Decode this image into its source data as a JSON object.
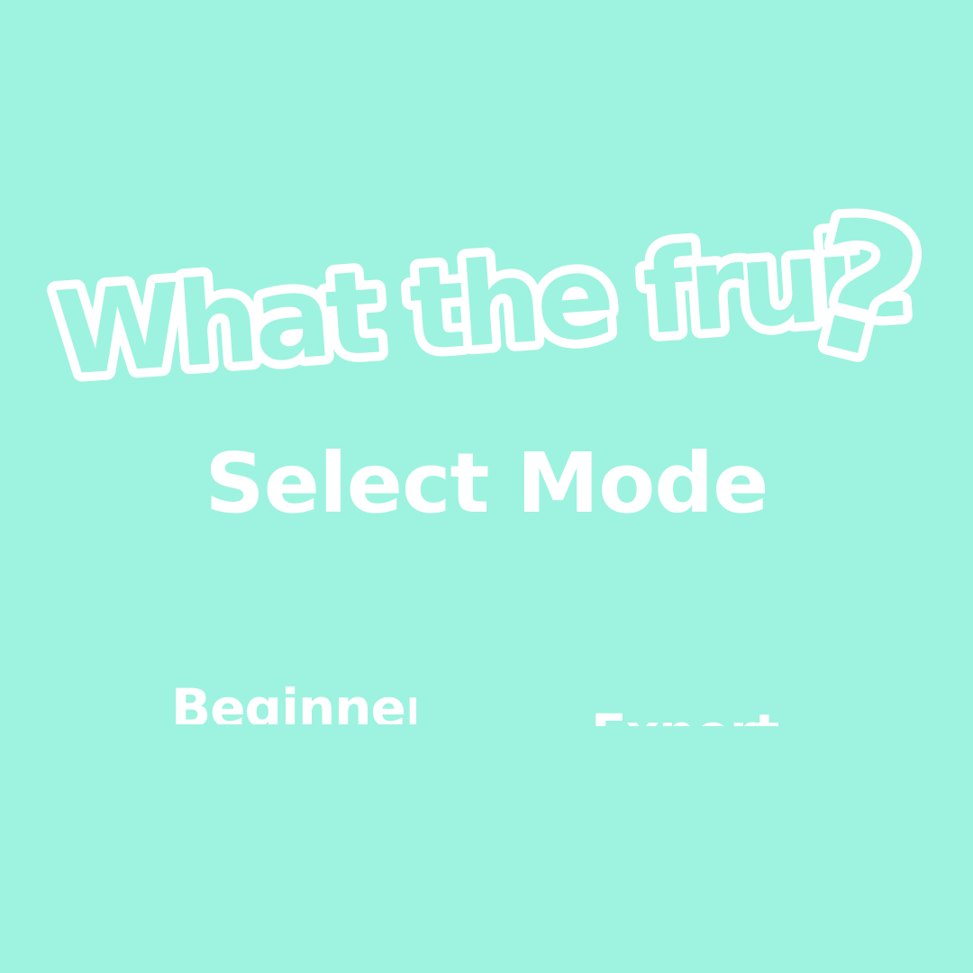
{
  "title": {
    "text": "What the fruit",
    "mark": "?"
  },
  "subtitle": "Select Mode",
  "modes": [
    {
      "label": "Beginner"
    },
    {
      "label": "Expert"
    }
  ],
  "colors": {
    "background": "#9df3df",
    "foreground": "#ffffff"
  }
}
